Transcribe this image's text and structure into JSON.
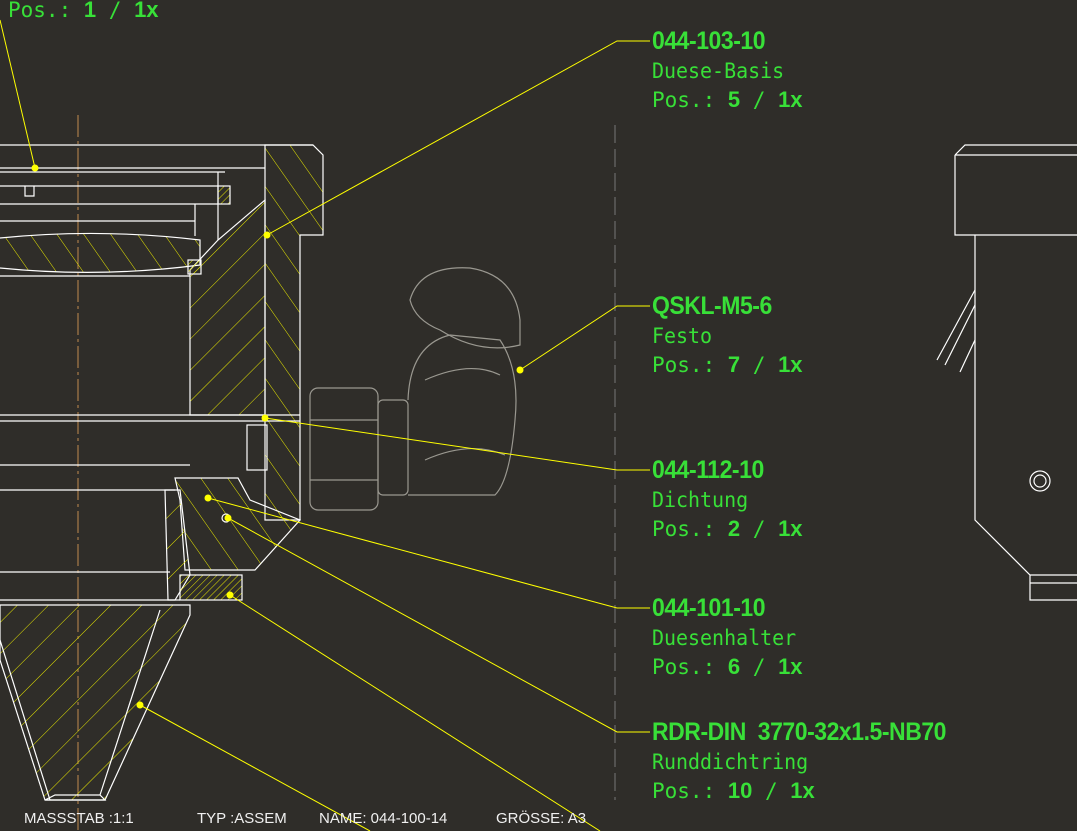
{
  "balloons": [
    {
      "part_number": "",
      "description": "",
      "pos_label": "Pos.:",
      "pos": "1",
      "qty": "1x"
    },
    {
      "part_number": "044-103-10",
      "description": "Duese-Basis",
      "pos_label": "Pos.:",
      "pos": "5",
      "qty": "1x"
    },
    {
      "part_number": "QSKL-M5-6",
      "description": "Festo",
      "pos_label": "Pos.:",
      "pos": "7",
      "qty": "1x"
    },
    {
      "part_number": "044-112-10",
      "description": "Dichtung",
      "pos_label": "Pos.:",
      "pos": "2",
      "qty": "1x"
    },
    {
      "part_number": "044-101-10",
      "description": "Duesenhalter",
      "pos_label": "Pos.:",
      "pos": "6",
      "qty": "1x"
    },
    {
      "part_number": "RDR-DIN  3770-32x1.5-NB70",
      "description": "Runddichtring",
      "pos_label": "Pos.:",
      "pos": "10",
      "qty": "1x"
    }
  ],
  "title_block": {
    "scale": "MASSSTAB :1:1",
    "type": "TYP :ASSEM",
    "name": "NAME: 044-100-14",
    "size": "GRÖSSE: A3"
  },
  "colors": {
    "background": "#2f2d29",
    "label": "#38e038",
    "leader": "#ffff00",
    "outline": "#ffffff",
    "hatch": "#e8e800"
  }
}
